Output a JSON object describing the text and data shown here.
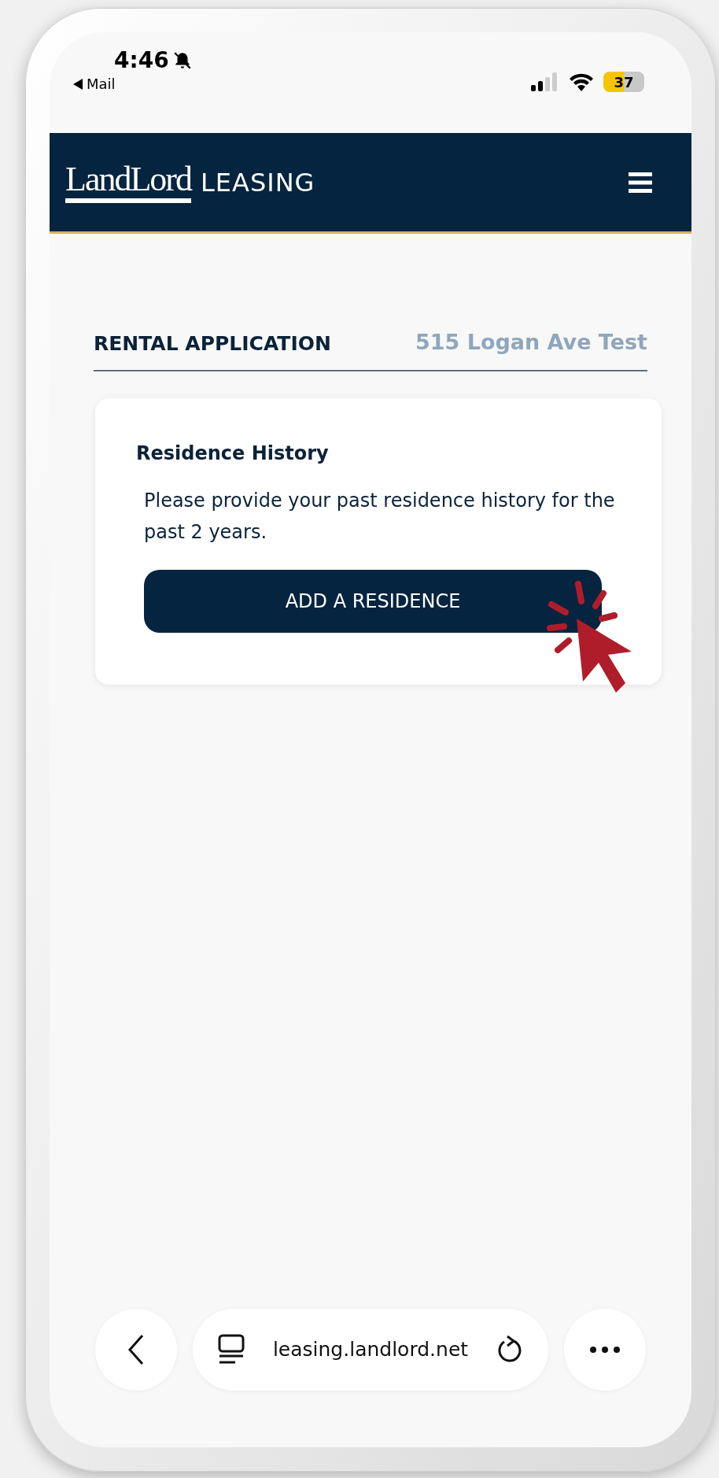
{
  "status_bar": {
    "time": "4:46",
    "back_app": "Mail",
    "battery": "37"
  },
  "header": {
    "logo": "LandLord",
    "brand": "LEASING"
  },
  "page": {
    "title": "RENTAL APPLICATION",
    "property": "515 Logan Ave Test"
  },
  "card": {
    "heading": "Residence History",
    "description": "Please provide your past residence history for the past 2 years.",
    "button": "ADD A RESIDENCE"
  },
  "browser_bar": {
    "url": "leasing.landlord.net"
  }
}
